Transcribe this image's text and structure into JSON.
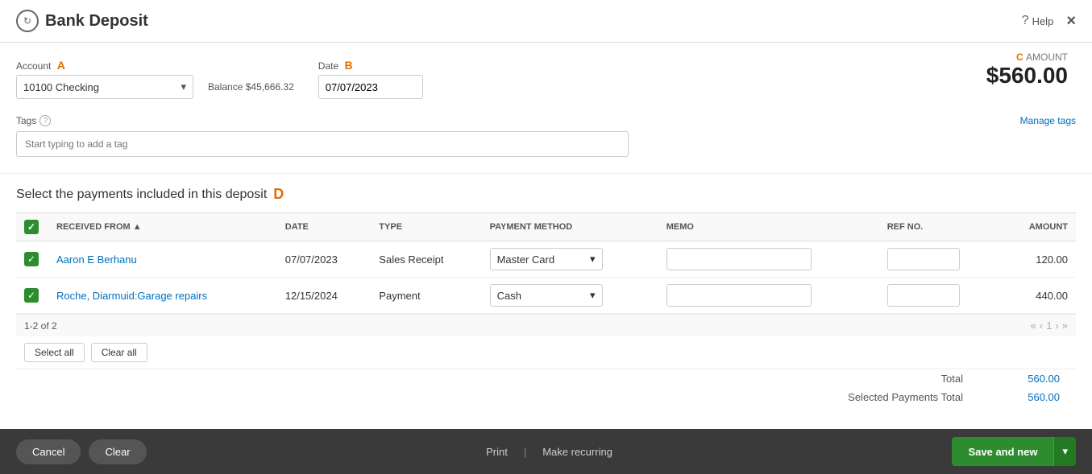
{
  "header": {
    "title": "Bank Deposit",
    "help_label": "Help",
    "close_label": "×"
  },
  "amount_section": {
    "letter": "C",
    "label": "AMOUNT",
    "value": "$560.00"
  },
  "account": {
    "label": "Account",
    "letter": "A",
    "value": "10100 Checking",
    "balance_label": "Balance",
    "balance_value": "$45,666.32"
  },
  "date": {
    "label": "Date",
    "letter": "B",
    "value": "07/07/2023"
  },
  "tags": {
    "label": "Tags",
    "manage_link": "Manage tags",
    "placeholder": "Start typing to add a tag"
  },
  "payments": {
    "section_title": "Select the payments included in this deposit",
    "section_letter": "D",
    "columns": [
      {
        "key": "received_from",
        "label": "RECEIVED FROM",
        "sortable": true
      },
      {
        "key": "date",
        "label": "DATE"
      },
      {
        "key": "type",
        "label": "TYPE"
      },
      {
        "key": "payment_method",
        "label": "PAYMENT METHOD"
      },
      {
        "key": "memo",
        "label": "MEMO"
      },
      {
        "key": "ref_no",
        "label": "REF NO."
      },
      {
        "key": "amount",
        "label": "AMOUNT"
      }
    ],
    "rows": [
      {
        "checked": true,
        "received_from": "Aaron E Berhanu",
        "date": "07/07/2023",
        "type": "Sales Receipt",
        "payment_method": "Master Card",
        "memo": "",
        "ref_no": "",
        "amount": "120.00"
      },
      {
        "checked": true,
        "received_from": "Roche, Diarmuid:Garage repairs",
        "date": "12/15/2024",
        "type": "Payment",
        "payment_method": "Cash",
        "memo": "",
        "ref_no": "",
        "amount": "440.00"
      }
    ],
    "pagination": {
      "info": "1-2 of 2",
      "first": "«",
      "prev": "‹",
      "page": "1",
      "next": "›",
      "last": "»"
    },
    "select_all": "Select all",
    "clear_all": "Clear all",
    "total_label": "Total",
    "total_value": "560.00",
    "selected_total_label": "Selected Payments Total",
    "selected_total_value": "560.00"
  },
  "footer": {
    "cancel_label": "Cancel",
    "clear_label": "Clear",
    "print_label": "Print",
    "make_recurring_label": "Make recurring",
    "save_new_label": "Save and new",
    "save_new_dropdown": "▾"
  }
}
